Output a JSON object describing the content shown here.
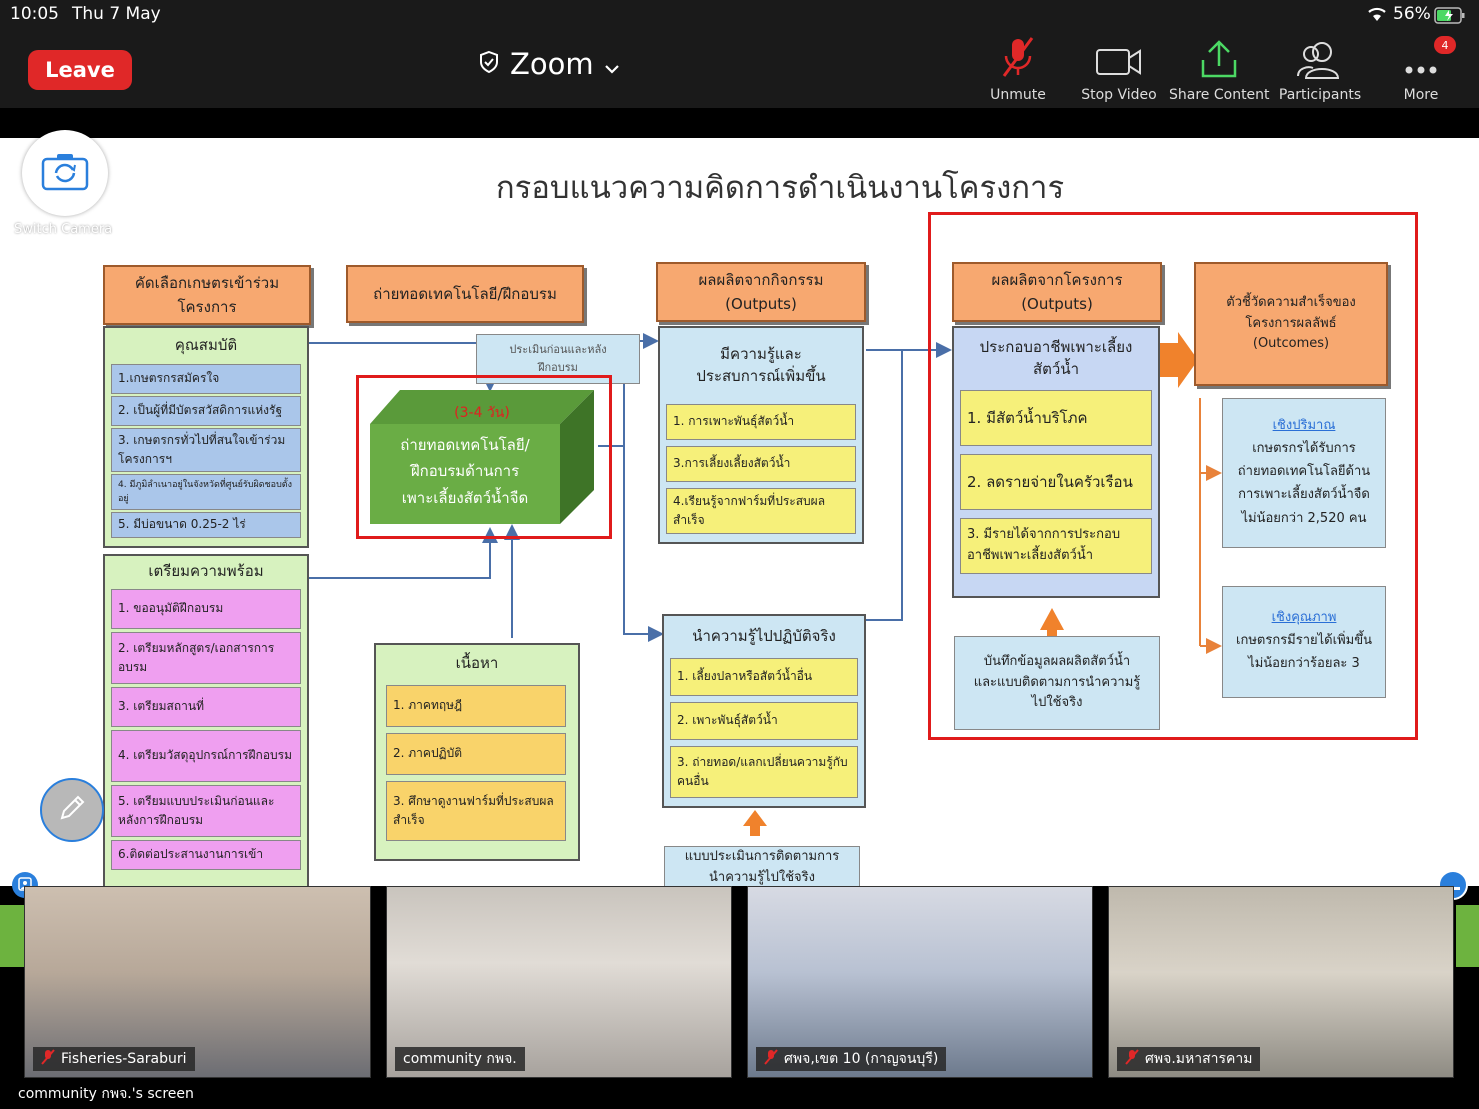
{
  "status": {
    "time": "10:05",
    "date": "Thu 7 May",
    "battery": "56%"
  },
  "meeting": {
    "leave_label": "Leave",
    "app_title": "Zoom"
  },
  "toolbar": [
    {
      "label": "Unmute",
      "icon": "mic-muted-icon"
    },
    {
      "label": "Stop Video",
      "icon": "video-camera-icon"
    },
    {
      "label": "Share Content",
      "icon": "share-upload-icon"
    },
    {
      "label": "Participants",
      "icon": "participants-icon"
    },
    {
      "label": "More",
      "icon": "more-dots-icon",
      "badge": "4"
    }
  ],
  "switch_camera_label": "Switch Camera",
  "slide": {
    "title": "กรอบแนวความคิดการดำเนินงานโครงการ",
    "col1_header": "คัดเลือกเกษตรเข้าร่วม\nโครงการ",
    "col2_header": "ถ่ายทอดเทคโนโลยี/ฝึกอบรม",
    "col3_header": "ผลผลิตจากกิจกรรม\n(Outputs)",
    "col4_header": "ผลผลิตจากโครงการ\n(Outputs)",
    "col5_header": "ตัวชี้วัดความสำเร็จของ\nโครงการผลลัพธ์\n(Outcomes)",
    "qualifications": {
      "title": "คุณสมบัติ",
      "items": [
        "1.เกษตรกรสมัครใจ",
        "2. เป็นผู้ที่มีบัตรสวัสดิการแห่งรัฐ",
        "3. เกษตรกรทั่วไปที่สนใจเข้าร่วมโครงการฯ",
        "4. มีภูมิลำเนาอยู่ในจังหวัดที่ศูนย์รับผิดชอบตั้งอยู่",
        "5. มีบ่อขนาด 0.25-2 ไร่"
      ]
    },
    "preparation": {
      "title": "เตรียมความพร้อม",
      "items": [
        "1. ขออนุมัติฝึกอบรม",
        "2. เตรียมหลักสูตร/เอกสารการอบรม",
        "3. เตรียมสถานที่",
        "4. เตรียมวัสดุอุปกรณ์การฝึกอบรม",
        "5. เตรียมแบบประเมินก่อนและหลังการฝึกอบรม",
        "6.ติดต่อประสานงานการเข้า"
      ]
    },
    "pre_post_eval": "ประเมินก่อนและหลัง\nฝึกอบรม",
    "training_box": {
      "duration": "(3-4 วัน)",
      "text": "ถ่ายทอดเทคโนโลยี/\nฝึกอบรมด้านการ\nเพาะเลี้ยงสัตว์น้ำจืด"
    },
    "content": {
      "title": "เนื้อหา",
      "items": [
        "1. ภาคทฤษฎี",
        "2. ภาคปฏิบัติ",
        "3. ศึกษาดูงานฟาร์มที่ประสบผลสำเร็จ"
      ]
    },
    "knowledge": {
      "title": "มีความรู้และ\nประสบการณ์เพิ่มขึ้น",
      "items": [
        "1. การเพาะพันธุ์สัตว์น้ำ",
        "3.การเลี้ยงเลี้ยงสัตว์น้ำ",
        "4.เรียนรู้จากฟาร์มที่ประสบผลสำเร็จ"
      ]
    },
    "apply": {
      "title": "นำความรู้ไปปฏิบัติจริง",
      "items": [
        "1. เลี้ยงปลาหรือสัตว์น้ำอื่น",
        "2. เพาะพันธุ์สัตว์น้ำ",
        "3. ถ่ายทอด/แลกเปลี่ยนความรู้กับคนอื่น"
      ]
    },
    "eval_followup": "แบบประเมินการติดตามการ\nนำความรู้ไปใช้จริง",
    "career": {
      "title": "ประกอบอาชีพเพาะเลี้ยง\nสัตว์น้ำ",
      "items": [
        "1. มีสัตว์น้ำบริโภค",
        "2. ลดรายจ่ายในครัวเรือน",
        "3. มีรายได้จากการประกอบอาชีพเพาะเลี้ยงสัตว์น้ำ"
      ]
    },
    "record": "บันทึกข้อมูลผลผลิตสัตว์น้ำ\nและแบบติดตามการนำความรู้\nไปใช้จริง",
    "quantity": {
      "title": "เชิงปริมาณ",
      "text": "เกษตรกรได้รับการ\nถ่ายทอดเทคโนโลยีด้าน\nการเพาะเลี้ยงสัตว์น้ำจืด\nไม่น้อยกว่า 2,520 คน"
    },
    "quality": {
      "title": "เชิงคุณภาพ",
      "text": "เกษตรกรมีรายได้เพิ่มขึ้น\nไม่น้อยกว่าร้อยละ 3"
    }
  },
  "participants": [
    {
      "name": "Fisheries-Saraburi",
      "muted": true
    },
    {
      "name": "community กพจ.",
      "muted": false
    },
    {
      "name": "ศพจ,เขต 10 (กาญจนบุรี)",
      "muted": true
    },
    {
      "name": "ศพจ.มหาสารคาม",
      "muted": true
    }
  ],
  "share_label": "community กพจ.'s screen"
}
